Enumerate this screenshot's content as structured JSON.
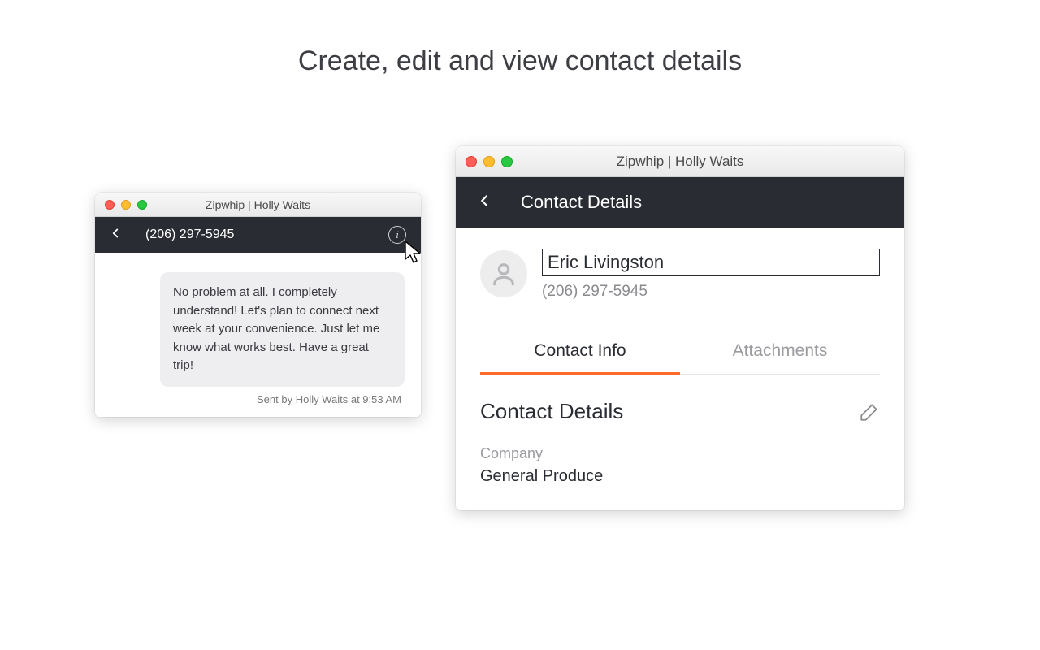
{
  "page_heading": "Create, edit and view contact details",
  "window1": {
    "title": "Zipwhip | Holly Waits",
    "header_phone": "(206) 297-5945",
    "message_text": "No problem at all.  I completely understand!  Let's plan to connect next week at your convenience.  Just let me know what works best.  Have a great trip!",
    "sent_by": "Sent by Holly Waits at 9:53 AM"
  },
  "window2": {
    "title": "Zipwhip | Holly Waits",
    "header_label": "Contact Details",
    "name_value": "Eric Livingston",
    "phone_value": "(206) 297-5945",
    "tabs": {
      "info": "Contact Info",
      "attachments": "Attachments"
    },
    "section_heading": "Contact Details",
    "company_label": "Company",
    "company_value": "General Produce"
  }
}
